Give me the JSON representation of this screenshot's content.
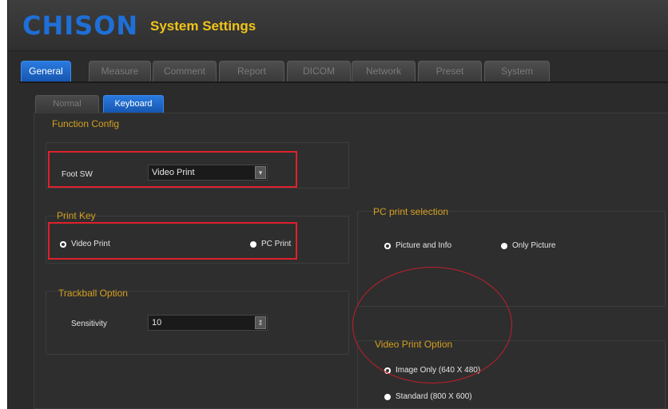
{
  "header": {
    "logo": "CHISON",
    "title": "System Settings"
  },
  "tabs": [
    {
      "label": "General",
      "active": true
    },
    {
      "label": "Measure",
      "active": false
    },
    {
      "label": "Comment",
      "active": false
    },
    {
      "label": "Report",
      "active": false
    },
    {
      "label": "DICOM",
      "active": false
    },
    {
      "label": "Network",
      "active": false
    },
    {
      "label": "Preset",
      "active": false
    },
    {
      "label": "System",
      "active": false
    }
  ],
  "subtabs": [
    {
      "label": "Normal",
      "active": false
    },
    {
      "label": "Keyboard",
      "active": true
    }
  ],
  "function_config": {
    "title": "Function Config",
    "foot_sw_label": "Foot SW",
    "foot_sw_value": "Video Print"
  },
  "print_key": {
    "title": "Print Key",
    "options": [
      {
        "label": "Video Print",
        "selected": true
      },
      {
        "label": "PC Print",
        "selected": false
      }
    ]
  },
  "trackball": {
    "title": "Trackball Option",
    "sensitivity_label": "Sensitivity",
    "sensitivity_value": "10"
  },
  "pc_print_selection": {
    "title": "PC print selection",
    "options": [
      {
        "label": "Picture and Info",
        "selected": true
      },
      {
        "label": "Only Picture",
        "selected": false
      }
    ]
  },
  "video_print_option": {
    "title": "Video Print Option",
    "options": [
      {
        "label": "Image Only (640 X 480)",
        "selected": true
      },
      {
        "label": "Standard (800 X 600)",
        "selected": false
      }
    ]
  },
  "colors": {
    "accent_blue": "#1f6fd8",
    "title_yellow": "#f0c419",
    "label_gold": "#d4a020",
    "highlight_red": "#e0202c"
  }
}
